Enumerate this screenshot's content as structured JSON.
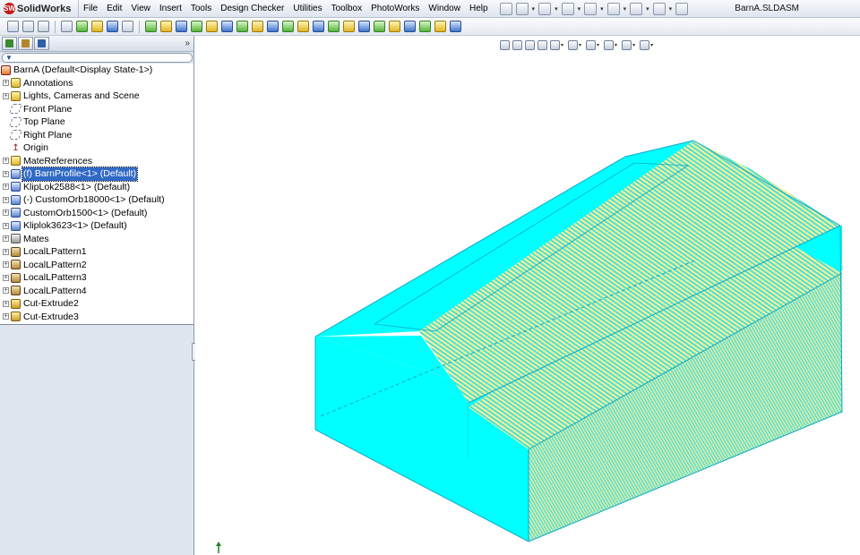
{
  "app": {
    "name": "SolidWorks",
    "document_title": "BarnA.SLDASM"
  },
  "menu": {
    "items": [
      "File",
      "Edit",
      "View",
      "Insert",
      "Tools",
      "Design Checker",
      "Utilities",
      "Toolbox",
      "PhotoWorks",
      "Window",
      "Help"
    ]
  },
  "menubar_icons": [
    "pushpin-icon",
    "new-document-icon",
    "open-icon",
    "save-icon",
    "print-icon",
    "undo-icon",
    "select-icon",
    "rebuild-icon",
    "options-icon"
  ],
  "toolbar": {
    "groups": [
      [
        "camera-icon",
        "edit-component-icon",
        "no-external-refs-icon"
      ],
      [
        "insert-component-icon",
        "mate-icon",
        "move-component-icon",
        "select-tool-icon",
        "smart-fasteners-icon"
      ],
      [
        "sketch-icon",
        "line-icon",
        "rectangle-icon",
        "circle-icon",
        "arc-icon",
        "spline-icon",
        "point-icon",
        "centerline-icon",
        "fillet-icon",
        "trim-icon",
        "offset-icon",
        "mirror-icon",
        "linear-pattern-icon",
        "display-relations-icon",
        "dimension-icon",
        "quick-snaps-icon",
        "grid-icon",
        "cut-extrude-icon",
        "hole-icon",
        "rapid-sketch-icon",
        "sketch-exit-icon"
      ]
    ]
  },
  "view_toolbar": {
    "icons": [
      "zoom-to-fit-icon",
      "zoom-area-icon",
      "previous-view-icon",
      "section-view-icon",
      "view-orientation-icon",
      "display-style-icon",
      "hide-show-icon",
      "edit-appearance-icon",
      "apply-scene-icon",
      "view-settings-icon"
    ]
  },
  "panel": {
    "tabs": [
      "feature-manager-icon",
      "property-manager-icon",
      "configuration-manager-icon"
    ],
    "expand_label": "»",
    "filter_label": "▼"
  },
  "tree": {
    "root": "BarnA  (Default<Display State-1>)",
    "items": [
      {
        "label": "Annotations",
        "icon": "annotations-icon",
        "expandable": true,
        "selected": false
      },
      {
        "label": "Lights, Cameras and Scene",
        "icon": "lights-icon",
        "expandable": true,
        "selected": false
      },
      {
        "label": "Front Plane",
        "icon": "plane-icon",
        "expandable": false,
        "selected": false
      },
      {
        "label": "Top Plane",
        "icon": "plane-icon",
        "expandable": false,
        "selected": false
      },
      {
        "label": "Right Plane",
        "icon": "plane-icon",
        "expandable": false,
        "selected": false
      },
      {
        "label": "Origin",
        "icon": "origin-icon",
        "expandable": false,
        "selected": false
      },
      {
        "label": "MateReferences",
        "icon": "mate-references-icon",
        "expandable": true,
        "selected": false
      },
      {
        "label": "(f) BarnProfile<1> (Default)",
        "icon": "part-icon",
        "expandable": true,
        "selected": true
      },
      {
        "label": "KlipLok2588<1> (Default)",
        "icon": "part-icon",
        "expandable": true,
        "selected": false
      },
      {
        "label": "(-) CustomOrb18000<1> (Default)",
        "icon": "part-icon",
        "expandable": true,
        "selected": false
      },
      {
        "label": "CustomOrb1500<1> (Default)",
        "icon": "part-icon",
        "expandable": true,
        "selected": false
      },
      {
        "label": "Kliplok3623<1> (Default)",
        "icon": "part-icon",
        "expandable": true,
        "selected": false
      },
      {
        "label": "Mates",
        "icon": "mates-icon",
        "expandable": true,
        "selected": false
      },
      {
        "label": "LocalLPattern1",
        "icon": "pattern-icon",
        "expandable": true,
        "selected": false
      },
      {
        "label": "LocalLPattern2",
        "icon": "pattern-icon",
        "expandable": true,
        "selected": false
      },
      {
        "label": "LocalLPattern3",
        "icon": "pattern-icon",
        "expandable": true,
        "selected": false
      },
      {
        "label": "LocalLPattern4",
        "icon": "pattern-icon",
        "expandable": true,
        "selected": false
      },
      {
        "label": "Cut-Extrude2",
        "icon": "cut-extrude-icon",
        "expandable": true,
        "selected": false
      },
      {
        "label": "Cut-Extrude3",
        "icon": "cut-extrude-icon",
        "expandable": true,
        "selected": false
      }
    ]
  },
  "model": {
    "name": "barn-model",
    "colors": {
      "body": "#00ffff",
      "body_edge": "#0aa8c8",
      "roof_stripe_a": "#f1ee9a",
      "roof_stripe_b": "#2fe0e0",
      "wall_stripe": "#d7e9a8"
    }
  }
}
